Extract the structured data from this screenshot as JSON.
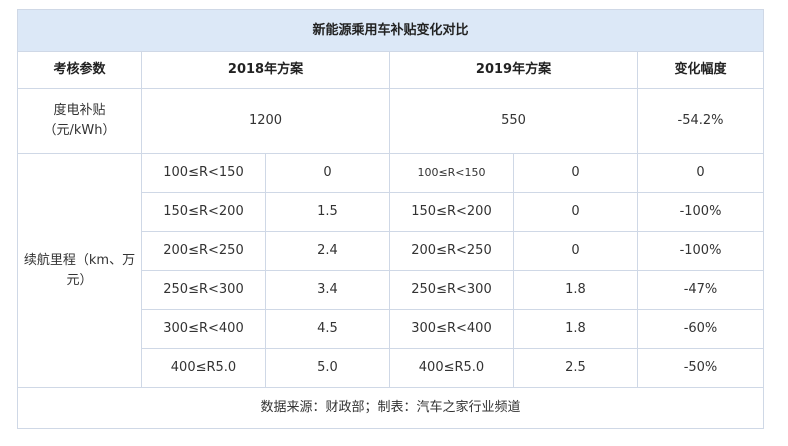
{
  "table": {
    "title": "新能源乘用车补贴变化对比",
    "headers": {
      "param": "考核参数",
      "plan2018": "2018年方案",
      "plan2019": "2019年方案",
      "change": "变化幅度"
    },
    "electricity": {
      "label": "度电补贴（元/kWh）",
      "v2018": "1200",
      "v2019": "550",
      "change": "-54.2%"
    },
    "range": {
      "label": "续航里程（km、万元）",
      "rows": [
        {
          "r2018": "100≤R<150",
          "v2018": "0",
          "r2019": "100≤R<150",
          "v2019": "0",
          "change": "0"
        },
        {
          "r2018": "150≤R<200",
          "v2018": "1.5",
          "r2019": "150≤R<200",
          "v2019": "0",
          "change": "-100%"
        },
        {
          "r2018": "200≤R<250",
          "v2018": "2.4",
          "r2019": "200≤R<250",
          "v2019": "0",
          "change": "-100%"
        },
        {
          "r2018": "250≤R<300",
          "v2018": "3.4",
          "r2019": "250≤R<300",
          "v2019": "1.8",
          "change": "-47%"
        },
        {
          "r2018": "300≤R<400",
          "v2018": "4.5",
          "r2019": "300≤R<400",
          "v2019": "1.8",
          "change": "-60%"
        },
        {
          "r2018": "400≤R5.0",
          "v2018": "5.0",
          "r2019": "400≤R5.0",
          "v2019": "2.5",
          "change": "-50%"
        }
      ]
    },
    "footer": "数据来源：财政部；制表：汽车之家行业频道"
  }
}
